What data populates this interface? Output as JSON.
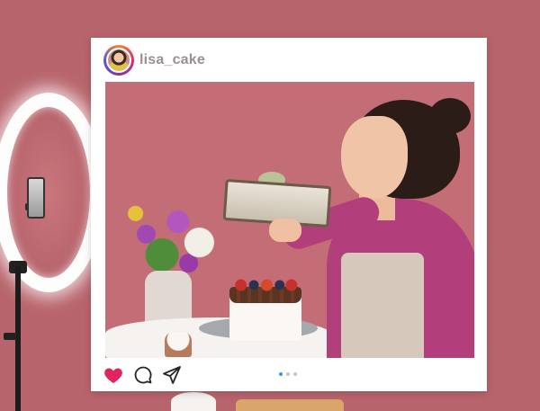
{
  "post": {
    "username": "lisa_cake",
    "carousel": {
      "count": 3,
      "active_index": 0
    }
  },
  "icons": {
    "like": "heart-icon",
    "comment": "comment-icon",
    "share": "send-icon"
  },
  "colors": {
    "background": "#b8646c",
    "like": "#e0245e",
    "carousel_active": "#3897f0",
    "carousel_inactive": "#c7c7c7",
    "username": "#9c8f94"
  }
}
